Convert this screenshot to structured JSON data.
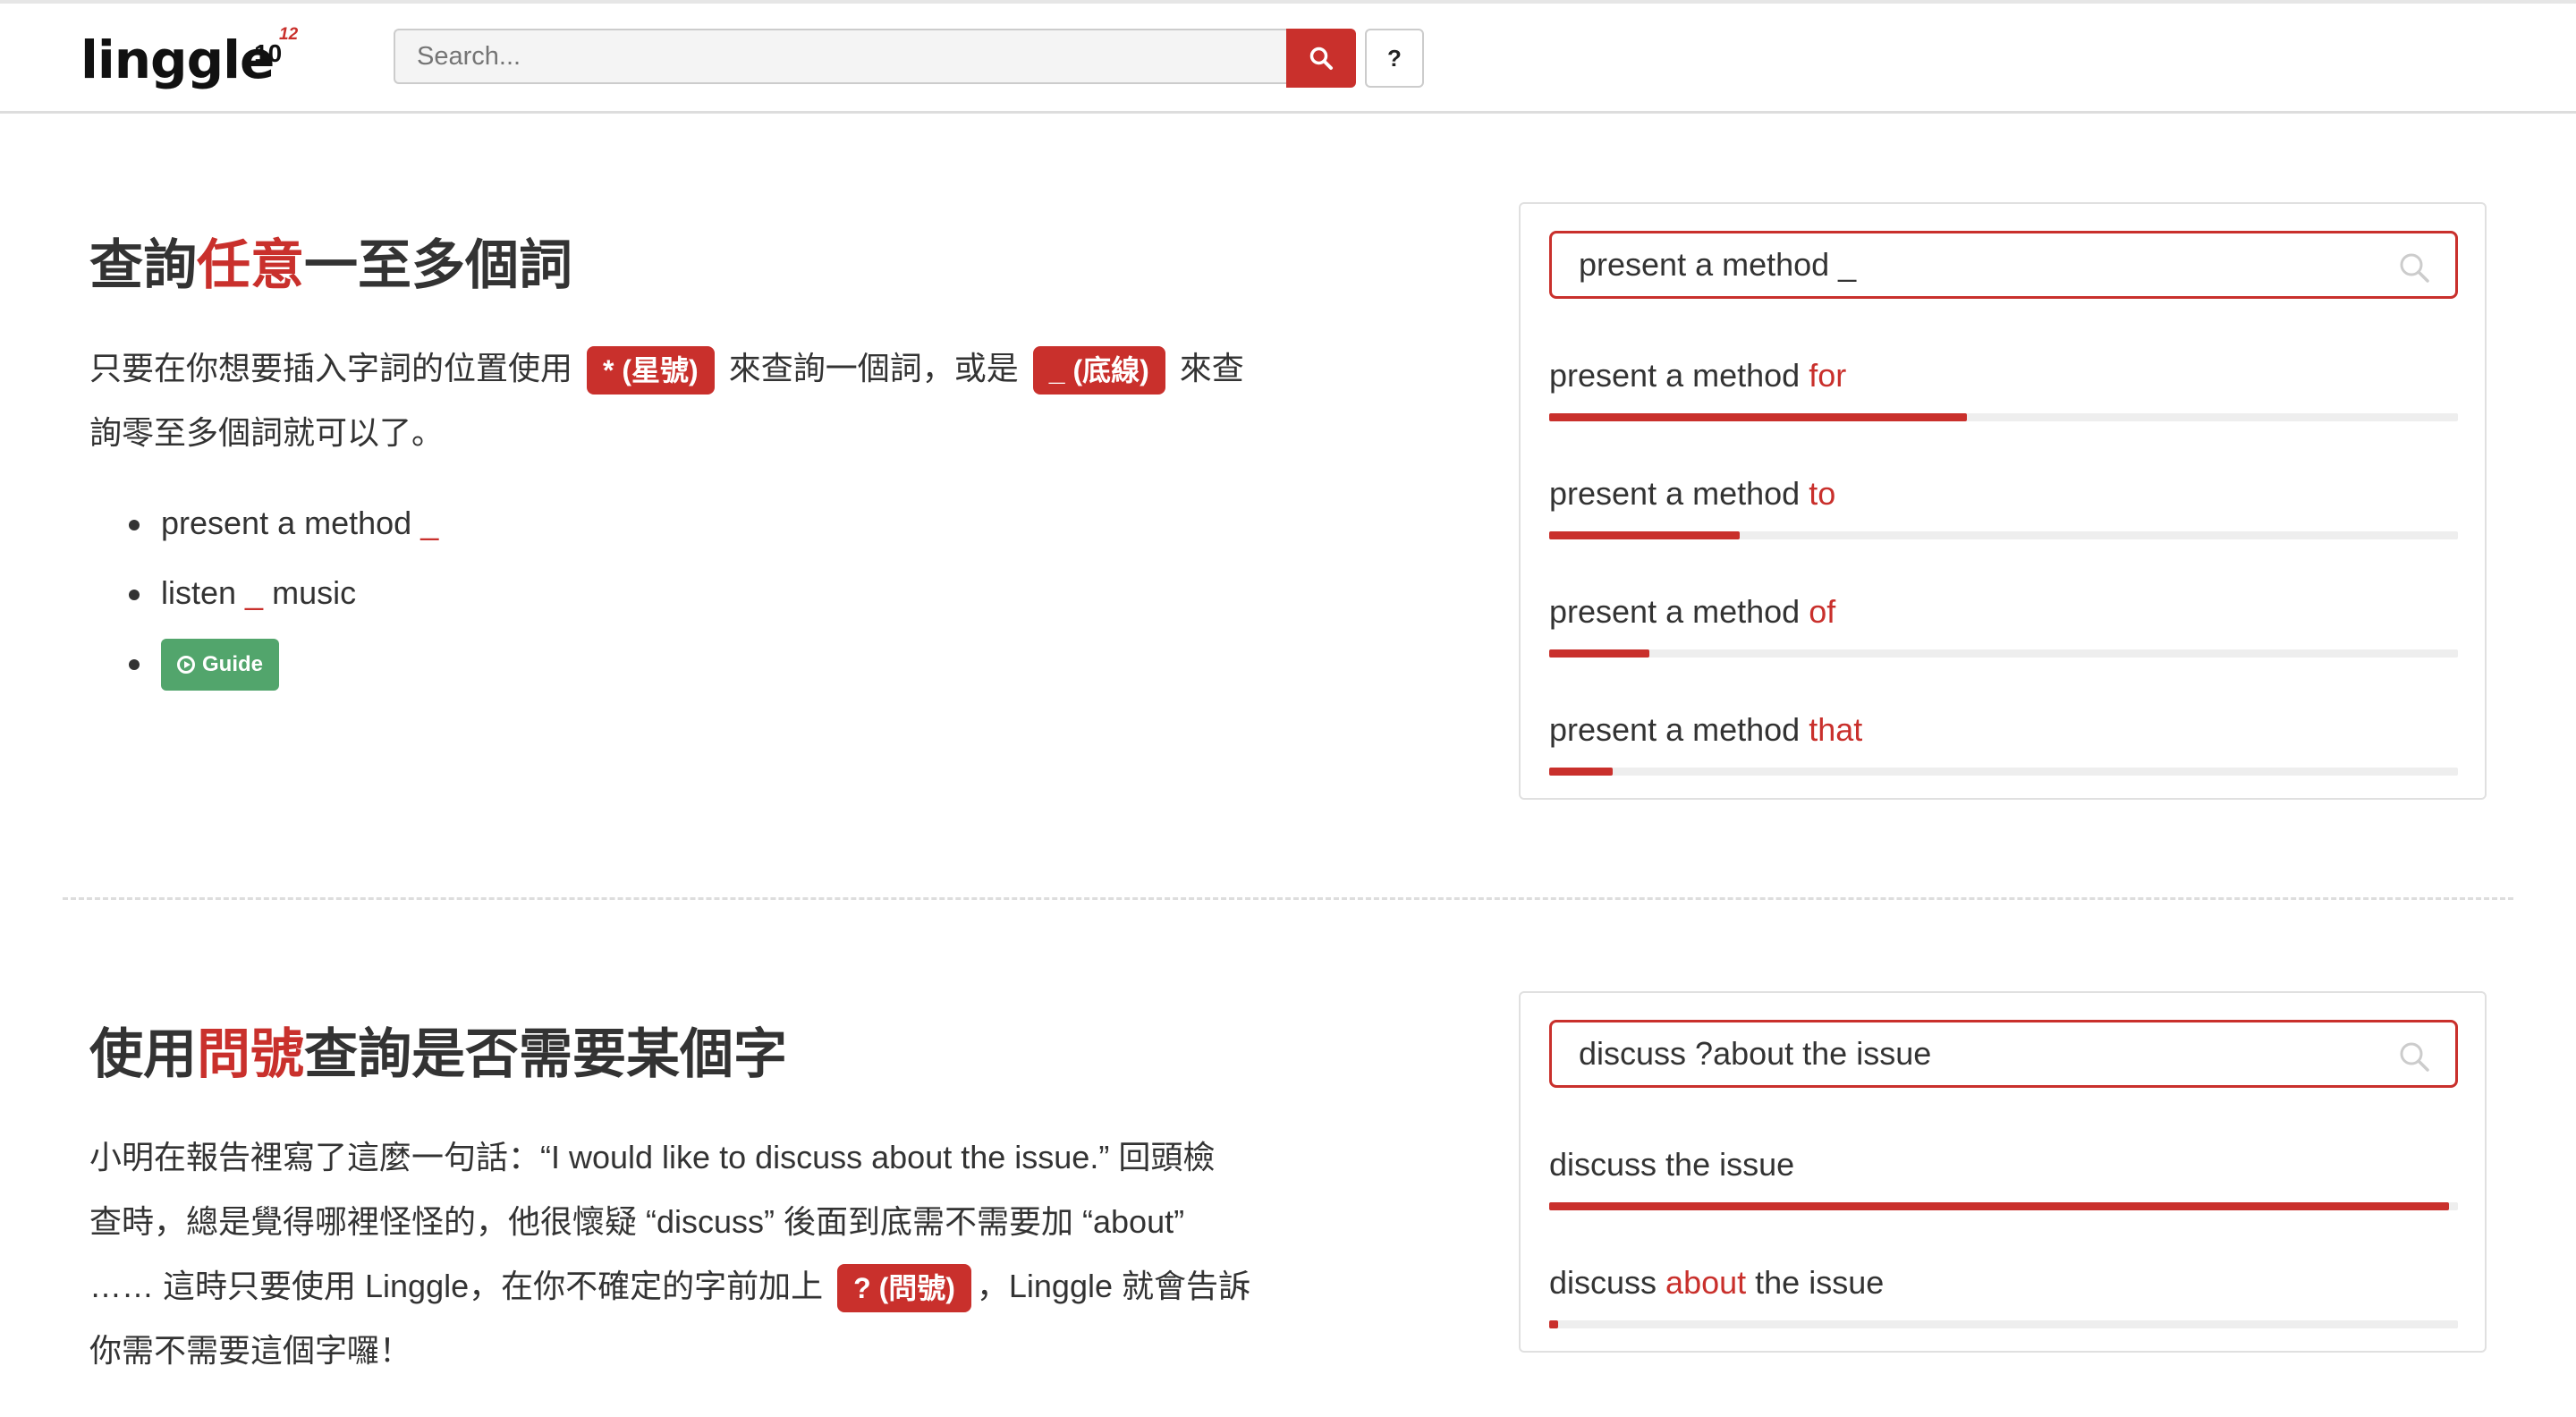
{
  "header": {
    "logo_text": "linggle",
    "logo_sup": "10",
    "logo_sup2": "12",
    "search_placeholder": "Search...",
    "help_label": "?"
  },
  "section1": {
    "title_pre": "查詢",
    "title_red": "任意",
    "title_post": "一至多個詞",
    "para_a": "只要在你想要插入字詞的位置使用",
    "badge_star": "* (星號)",
    "para_b": "來查詢一個詞，或是",
    "badge_underscore": "_ (底線)",
    "para_c": "來查",
    "para_d": "詢零至多個詞就可以了。",
    "examples": [
      {
        "pre": "present a method ",
        "red": "_",
        "post": ""
      },
      {
        "pre": "listen ",
        "red": "_",
        "post": " music"
      }
    ],
    "guide_label": "Guide",
    "panel": {
      "query": "present a method _",
      "results": [
        {
          "base": "present a method ",
          "word": "for",
          "ratio": 0.46
        },
        {
          "base": "present a method ",
          "word": "to",
          "ratio": 0.21
        },
        {
          "base": "present a method ",
          "word": "of",
          "ratio": 0.11
        },
        {
          "base": "present a method ",
          "word": "that",
          "ratio": 0.07
        }
      ]
    }
  },
  "section2": {
    "title_pre": "使用",
    "title_red": "問號",
    "title_post": "查詢是否需要某個字",
    "line1": "小明在報告裡寫了這麼一句話：“I would like to discuss about the issue.” 回頭檢",
    "line2": "查時，總是覺得哪裡怪怪的，他很懷疑 “discuss” 後面到底需不需要加 “about”",
    "line3_a": "…… 這時只要使用 Linggle，在你不確定的字前加上",
    "badge_question": "? (問號)",
    "line3_b": "，Linggle 就會告訴",
    "line4": "你需不需要這個字囉！",
    "panel": {
      "query": "discuss ?about the issue",
      "results": [
        {
          "pre": "discuss ",
          "word": "",
          "post": "the issue",
          "ratio": 0.99
        },
        {
          "pre": "discuss ",
          "word": "about",
          "post": " the issue",
          "ratio": 0.01
        }
      ]
    }
  },
  "colors": {
    "accent": "#c9302c",
    "guide_green": "#52a56c"
  }
}
